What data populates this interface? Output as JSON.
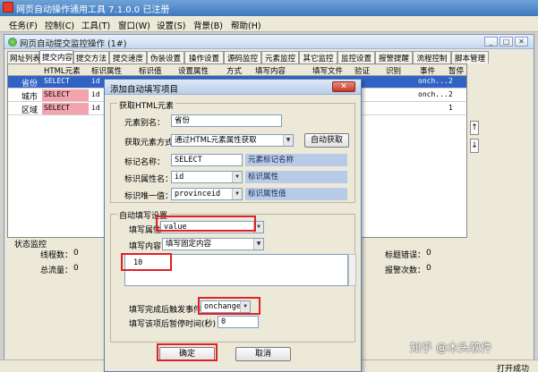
{
  "app": {
    "title": "网页自动操作通用工具 7.1.0.0 已注册"
  },
  "menu": [
    "任务(F)",
    "控制(C)",
    "工具(T)",
    "窗口(W)",
    "设置(S)",
    "背景(B)",
    "帮助(H)"
  ],
  "inner_window": {
    "title": "网页自动提交监控操作 (1#)",
    "controls": [
      "_",
      "□",
      "✕"
    ]
  },
  "tabs": [
    "网址列表",
    "提交内容",
    "提交方法",
    "提交速度",
    "伪装设置",
    "操作设置",
    "源码监控",
    "元素监控",
    "其它监控",
    "监控设置",
    "报警提醒",
    "流程控制",
    "脚本管理"
  ],
  "grid": {
    "headers": [
      "HTML元素",
      "标识属性",
      "标识值",
      "设置属性",
      "方式",
      "填写内容",
      "填写文件",
      "验证",
      "识别",
      "事件",
      "暂停"
    ],
    "rows": [
      {
        "label": "省份",
        "element": "SELECT",
        "attr": "id",
        "event": "onch...",
        "pause": "2"
      },
      {
        "label": "城市",
        "element": "SELECT",
        "attr": "id",
        "event": "onch...",
        "pause": "2"
      },
      {
        "label": "区域",
        "element": "SELECT",
        "attr": "id",
        "event": "",
        "pause": "1"
      }
    ],
    "side_buttons": [
      "↑",
      "↓"
    ]
  },
  "status_monitor": {
    "title": "状态监控",
    "thread_label": "线程数：",
    "thread_value": "0",
    "traffic_label": "总流量：",
    "traffic_value": "0",
    "tag_error_label": "标题错误：",
    "tag_error_value": "0",
    "alarm_label": "报警次数：",
    "alarm_value": "0"
  },
  "statusbar": {
    "text": "打开成功"
  },
  "dialog": {
    "title": "添加自动填写项目",
    "close": "✕",
    "section_get": "获取HTML元素",
    "alias_label": "元素别名：",
    "alias_value": "省份",
    "method_label": "获取元素方式",
    "method_value": "通过HTML元素属性获取",
    "auto_get_button": "自动获取",
    "tag_label": "标记名称：",
    "tag_value": "SELECT",
    "tag_hint": "元素标记名称",
    "attr_label": "标识属性名：",
    "attr_value": "id",
    "attr_hint": "标识属性",
    "unique_label": "标识唯一值：",
    "unique_value": "provinceid",
    "unique_hint": "标识属性值",
    "section_fill": "自动填写设置",
    "fill_attr_label": "填写属性：",
    "fill_attr_value": "value",
    "fill_content_label": "填写内容：",
    "fill_content_value": "填写固定内容",
    "content_text": "10",
    "trigger_label": "填写完成后触发事件",
    "trigger_value": "onchange",
    "pause_label": "填写该项后暂停时间(秒)",
    "pause_value": "0",
    "ok_button": "确定",
    "cancel_button": "取消"
  },
  "watermark": "知乎 @木头软件",
  "colors": {
    "highlight": "#e0202a",
    "selected_row": "#3163c5",
    "pink_cell": "#f2a3ad"
  }
}
